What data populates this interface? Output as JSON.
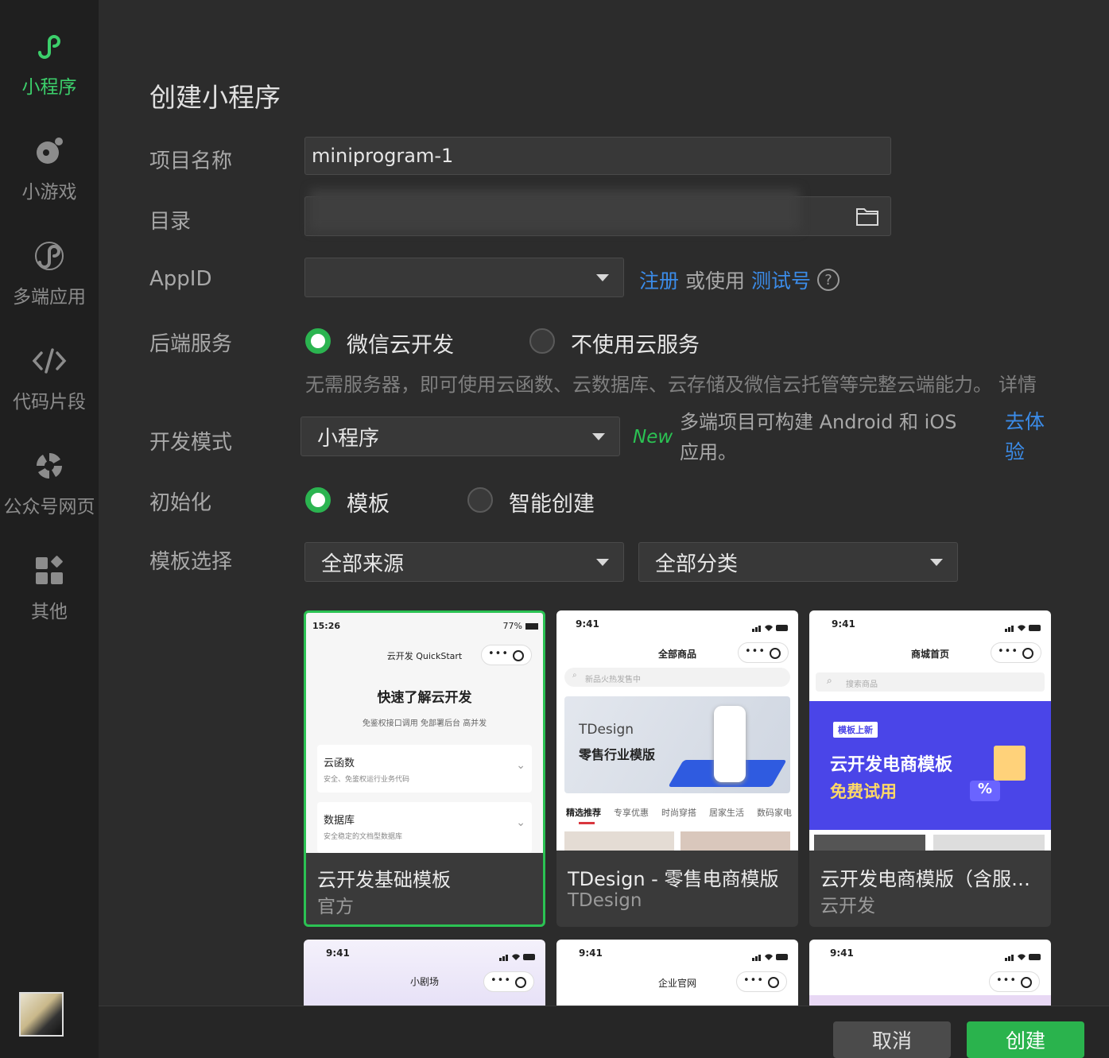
{
  "sidebar": {
    "items": [
      {
        "label": "小程序",
        "icon": "miniprogram-icon",
        "active": true
      },
      {
        "label": "小游戏",
        "icon": "minigame-icon"
      },
      {
        "label": "多端应用",
        "icon": "multiplatform-icon"
      },
      {
        "label": "代码片段",
        "icon": "code-icon"
      },
      {
        "label": "公众号网页",
        "icon": "webpage-icon"
      },
      {
        "label": "其他",
        "icon": "apps-icon"
      }
    ]
  },
  "form": {
    "title": "创建小程序",
    "project_name": {
      "label": "项目名称",
      "value": "miniprogram-1"
    },
    "directory": {
      "label": "目录",
      "value": ""
    },
    "appid": {
      "label": "AppID",
      "value": "",
      "register_link": "注册",
      "or_use": "或使用",
      "test_link": "测试号",
      "help": "?"
    },
    "backend": {
      "label": "后端服务",
      "option_cloud": "微信云开发",
      "option_none": "不使用云服务",
      "hint": "无需服务器，即可使用云函数、云数据库、云存储及微信云托管等完整云端能力。",
      "detail_link": "详情"
    },
    "dev_mode": {
      "label": "开发模式",
      "value": "小程序",
      "new_badge": "New",
      "hint": "多端项目可构建 Android 和 iOS 应用。",
      "try_link": "去体验"
    },
    "init": {
      "label": "初始化",
      "option_template": "模板",
      "option_smart": "智能创建"
    },
    "template_select": {
      "label": "模板选择",
      "source": "全部来源",
      "category": "全部分类"
    }
  },
  "templates": [
    {
      "name": "云开发基础模板",
      "org": "官方",
      "preview": {
        "time": "15:26",
        "battery": "77%",
        "nav": "云开发 QuickStart",
        "heading": "快速了解云开发",
        "sub": "免鉴权接口调用 免部署后台 高并发",
        "rows": [
          {
            "title": "云函数",
            "desc": "安全、免鉴权运行业务代码"
          },
          {
            "title": "数据库",
            "desc": "安全稳定的文档型数据库"
          }
        ]
      }
    },
    {
      "name": "TDesign - 零售电商模版",
      "org": "TDesign",
      "preview": {
        "time": "9:41",
        "nav": "全部商品",
        "search": "新品火热发售中",
        "banner1": "TDesign",
        "banner2": "零售行业模版",
        "tabs": [
          "精选推荐",
          "专享优惠",
          "时尚穿搭",
          "居家生活",
          "数码家电"
        ]
      }
    },
    {
      "name": "云开发电商模版（含服务端）",
      "org": "云开发",
      "preview": {
        "time": "9:41",
        "nav": "商城首页",
        "search": "搜索商品",
        "badge": "模板上新",
        "banner1": "云开发电商模板",
        "banner2": "免费试用",
        "percent": "%"
      }
    },
    {
      "name": "",
      "org": "",
      "preview": {
        "time": "9:41",
        "nav": "小剧场"
      }
    },
    {
      "name": "",
      "org": "",
      "preview": {
        "time": "9:41",
        "nav": "企业官网"
      }
    },
    {
      "name": "",
      "org": "",
      "preview": {
        "time": "9:41",
        "nav": ""
      }
    }
  ],
  "footer": {
    "cancel": "取消",
    "create": "创建"
  },
  "colors": {
    "accent": "#2ab34d",
    "link": "#3b8ce9",
    "background": "#2c2c2c",
    "sidebar": "#1f1f1f"
  }
}
